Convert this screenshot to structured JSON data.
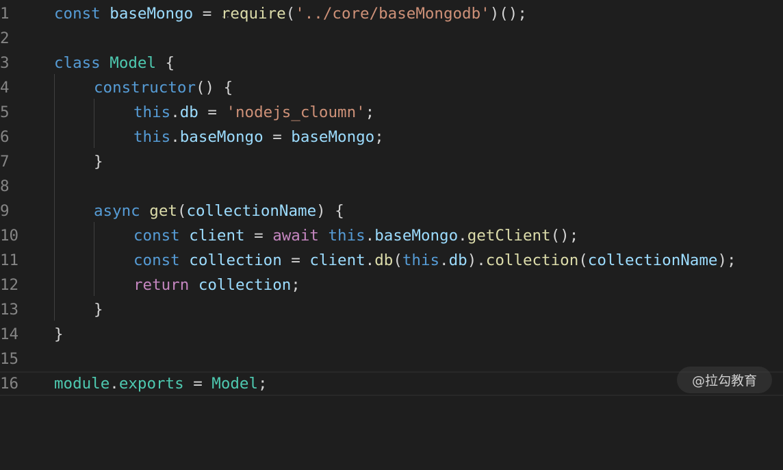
{
  "editor": {
    "line_numbers": [
      "1",
      "2",
      "3",
      "4",
      "5",
      "6",
      "7",
      "8",
      "9",
      "10",
      "11",
      "12",
      "13",
      "14",
      "15",
      "16"
    ],
    "current_line": 16
  },
  "code": {
    "l1": {
      "const": "const",
      "baseMongo": "baseMongo",
      "eq": " = ",
      "require": "require",
      "open": "(",
      "path": "'../core/baseMongodb'",
      "close": ")();"
    },
    "l3": {
      "class": "class",
      "name": "Model",
      "brace": " {"
    },
    "l4": {
      "ctor": "constructor",
      "rest": "() {"
    },
    "l5": {
      "this": "this",
      "dot": ".",
      "db": "db",
      "eq": " = ",
      "str": "'nodejs_cloumn'",
      "semi": ";"
    },
    "l6": {
      "this": "this",
      "dot": ".",
      "prop": "baseMongo",
      "eq": " = ",
      "val": "baseMongo",
      "semi": ";"
    },
    "l7": {
      "brace": "}"
    },
    "l9": {
      "async": "async",
      "get": "get",
      "open": "(",
      "param": "collectionName",
      "close": ") {"
    },
    "l10": {
      "const": "const",
      "client": "client",
      "eq": " = ",
      "await": "await",
      "this": "this",
      "dot1": ".",
      "baseMongo": "baseMongo",
      "dot2": ".",
      "fn": "getClient",
      "end": "();"
    },
    "l11": {
      "const": "const",
      "collection": "collection",
      "eq": " = ",
      "client": "client",
      "dot1": ".",
      "db": "db",
      "open1": "(",
      "this": "this",
      "dot2": ".",
      "db2": "db",
      "close1": ").",
      "fn": "collection",
      "open2": "(",
      "param": "collectionName",
      "end": ");"
    },
    "l12": {
      "return": "return",
      "val": "collection",
      "semi": ";"
    },
    "l13": {
      "brace": "}"
    },
    "l14": {
      "brace": "}"
    },
    "l16": {
      "module": "module",
      "dot": ".",
      "exports": "exports",
      "eq": " = ",
      "name": "Model",
      "semi": ";"
    }
  },
  "hint": {
    "dots": "···"
  },
  "watermark": {
    "text": "@拉勾教育"
  },
  "colors": {
    "background": "#1e1e1e",
    "keyword": "#569cd6",
    "control": "#c586c0",
    "variable": "#9cdcfe",
    "class": "#4ec9b0",
    "function": "#dcdcaa",
    "string": "#ce9178",
    "line_number": "#858585"
  }
}
